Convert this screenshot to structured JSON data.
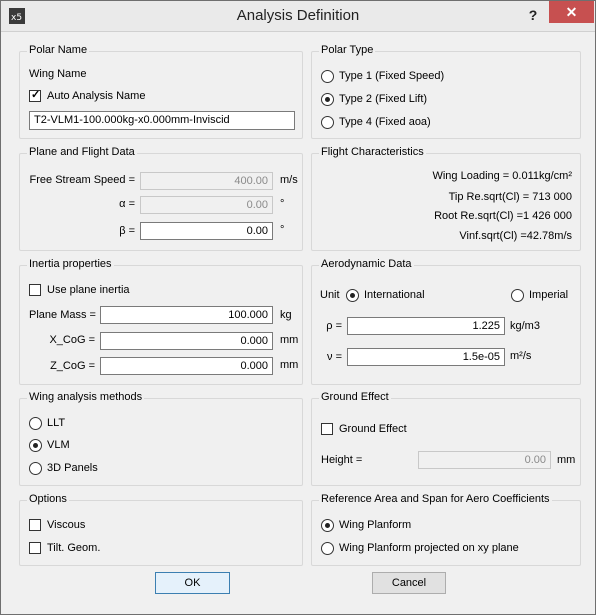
{
  "window": {
    "title": "Analysis Definition",
    "help": "?",
    "close": "✕",
    "app_icon": "xflr5-app-icon"
  },
  "polar_name": {
    "title": "Polar Name",
    "wing_name_label": "Wing Name",
    "auto_checkbox_label": "Auto Analysis Name",
    "auto_checked": true,
    "name_value": "T2-VLM1-100.000kg-x0.000mm-Inviscid"
  },
  "polar_type": {
    "title": "Polar Type",
    "options": [
      "Type 1 (Fixed Speed)",
      "Type 2 (Fixed Lift)",
      "Type 4 (Fixed aoa)"
    ],
    "selected_index": 1
  },
  "plane_flight": {
    "title": "Plane and Flight Data",
    "speed_label": "Free Stream Speed =",
    "speed_value": "400.00",
    "speed_unit": "m/s",
    "alpha_label": "α =",
    "alpha_value": "0.00",
    "alpha_unit": "°",
    "beta_label": "β =",
    "beta_value": "0.00",
    "beta_unit": "°"
  },
  "flight_characteristics": {
    "title": "Flight Characteristics",
    "wing_loading": "Wing Loading =   0.011kg/cm²",
    "tip_re": "Tip Re.sqrt(Cl) =  713 000",
    "root_re": "Root Re.sqrt(Cl) =1 426 000",
    "vinf": "Vinf.sqrt(Cl) =42.78m/s"
  },
  "inertia": {
    "title": "Inertia properties",
    "use_plane_inertia_label": "Use plane inertia",
    "use_plane_inertia_checked": false,
    "mass_label": "Plane Mass =",
    "mass_value": "100.000",
    "mass_unit": "kg",
    "xcog_label": "X_CoG =",
    "xcog_value": "0.000",
    "xcog_unit": "mm",
    "zcog_label": "Z_CoG =",
    "zcog_value": "0.000",
    "zcog_unit": "mm"
  },
  "aero": {
    "title": "Aerodynamic Data",
    "unit_label": "Unit",
    "international_label": "International",
    "imperial_label": "Imperial",
    "selected_unit": "International",
    "rho_label": "ρ =",
    "rho_value": "1.225",
    "rho_unit": "kg/m3",
    "nu_label": "ν =",
    "nu_value": "1.5e-05",
    "nu_unit": "m²/s"
  },
  "wing_methods": {
    "title": "Wing analysis methods",
    "options": [
      "LLT",
      "VLM",
      "3D Panels"
    ],
    "selected_index": 1
  },
  "ground_effect": {
    "title": "Ground Effect",
    "checkbox_label": "Ground Effect",
    "checked": false,
    "height_label": "Height =",
    "height_value": "0.00",
    "height_unit": "mm"
  },
  "options": {
    "title": "Options",
    "viscous_label": "Viscous",
    "viscous_checked": false,
    "tilt_label": "Tilt. Geom.",
    "tilt_checked": false
  },
  "reference": {
    "title": "Reference Area and Span for Aero Coefficients",
    "options": [
      "Wing Planform",
      "Wing Planform projected on xy plane"
    ],
    "selected_index": 0
  },
  "buttons": {
    "ok": "OK",
    "cancel": "Cancel"
  }
}
